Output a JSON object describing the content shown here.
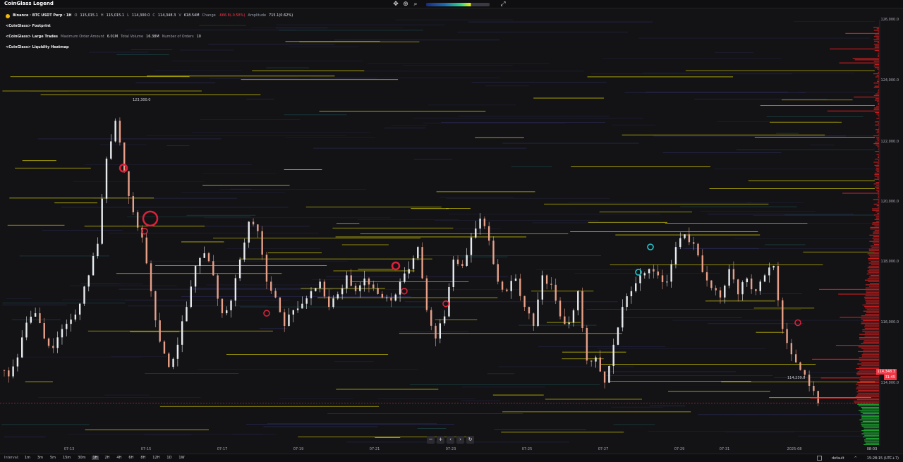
{
  "app": {
    "title": "CoinGlass Legend"
  },
  "toolbar": {
    "icons": [
      "move-icon",
      "zoom-icon",
      "search-icon",
      "heatmap-range-slider",
      "expand-icon"
    ]
  },
  "legend": {
    "symbol": "Binance · BTC USDT Perp · 1H",
    "o_label": "O",
    "o": "115,015.1",
    "h_label": "H",
    "h": "115,015.1",
    "l_label": "L",
    "l": "114,300.0",
    "c_label": "C",
    "c": "114,348.3",
    "v_label": "V",
    "v": "618.54M",
    "change_label": "Change",
    "change": "-666.8(-0.58%)",
    "amp_label": "Amplitude",
    "amp": "715.1(0.62%)",
    "footprint": "<CoinGlass> Footprint",
    "large_trades": "<CoinGlass> Large Trades",
    "max_order_label": "Maximum Order Amount",
    "max_order": "6.01M",
    "total_vol_label": "Total Volume",
    "total_vol": "16.38M",
    "num_orders_label": "Number of Orders",
    "num_orders": "10",
    "liq_heatmap": "<CoinGlass> Liquidity Heatmap"
  },
  "y_axis": [
    "126,000.0",
    "124,000.0",
    "122,000.0",
    "120,000.0",
    "118,000.0",
    "116,000.0",
    "114,000.0"
  ],
  "price_badge": "114,348.3",
  "price_badge_sub": "31:45",
  "annotations": {
    "high": "123,300.0",
    "low": "114,239.8"
  },
  "x_axis": [
    "07-13",
    "07-15",
    "07-17",
    "07-19",
    "07-21",
    "07-23",
    "07-25",
    "07-27",
    "07-29",
    "07-31",
    "2025-08",
    "08-03"
  ],
  "intervals": {
    "label": "Interval:",
    "items": [
      "1m",
      "3m",
      "5m",
      "15m",
      "30m",
      "1H",
      "2H",
      "4H",
      "6H",
      "8H",
      "12H",
      "1D",
      "1W"
    ],
    "active": "1H"
  },
  "bottom_right": {
    "default_label": "default",
    "time": "15:28:15 (UTC+7)"
  },
  "nav": {
    "zoom_out": "−",
    "zoom_in": "+",
    "prev": "‹",
    "next": "›",
    "reset": "↻"
  },
  "colors": {
    "up": "#e8ecef",
    "down": "#e8a088",
    "bid_volume": "#22d33a",
    "ask_volume": "#e02020",
    "heat_line": "#d8d000",
    "bubble_red": "#e0203a",
    "bubble_cyan": "#21c9cf"
  },
  "chart_data": {
    "type": "candlestick-heatmap",
    "y_range": [
      113000,
      126500
    ],
    "close_series": [
      115200,
      115800,
      116900,
      117200,
      116400,
      116100,
      116700,
      117000,
      117500,
      118400,
      119400,
      122100,
      123300,
      121700,
      120400,
      119600,
      117900,
      116300,
      115500,
      116200,
      117400,
      118700,
      119100,
      118400,
      117200,
      117600,
      118900,
      120100,
      119800,
      118200,
      117700,
      116800,
      117300,
      117500,
      117900,
      118200,
      117400,
      117800,
      118400,
      117900,
      118300,
      118000,
      117700,
      117600,
      118200,
      118600,
      119300,
      117300,
      116400,
      117100,
      118900,
      118700,
      119600,
      120200,
      119500,
      118200,
      117900,
      118300,
      117400,
      116800,
      118400,
      118100,
      117100,
      116900,
      117900,
      115700,
      115800,
      115000,
      116200,
      117400,
      117900,
      118400,
      118600,
      118400,
      118200,
      119300,
      119700,
      119400,
      118500,
      118000,
      117700,
      118600,
      117800,
      118300,
      117900,
      118400,
      118700,
      116700,
      115900,
      115400,
      114900,
      114350
    ],
    "markers": [
      {
        "price": 121800,
        "type": "buy-large"
      },
      {
        "price": 120200,
        "type": "buy-large"
      },
      {
        "price": 119800,
        "type": "sell"
      },
      {
        "price": 118700,
        "type": "buy-large"
      },
      {
        "price": 117900,
        "type": "sell"
      },
      {
        "price": 117500,
        "type": "sell"
      },
      {
        "price": 119300,
        "type": "buy"
      },
      {
        "price": 118500,
        "type": "buy"
      },
      {
        "price": 117200,
        "type": "sell"
      },
      {
        "price": 116900,
        "type": "sell"
      }
    ]
  }
}
